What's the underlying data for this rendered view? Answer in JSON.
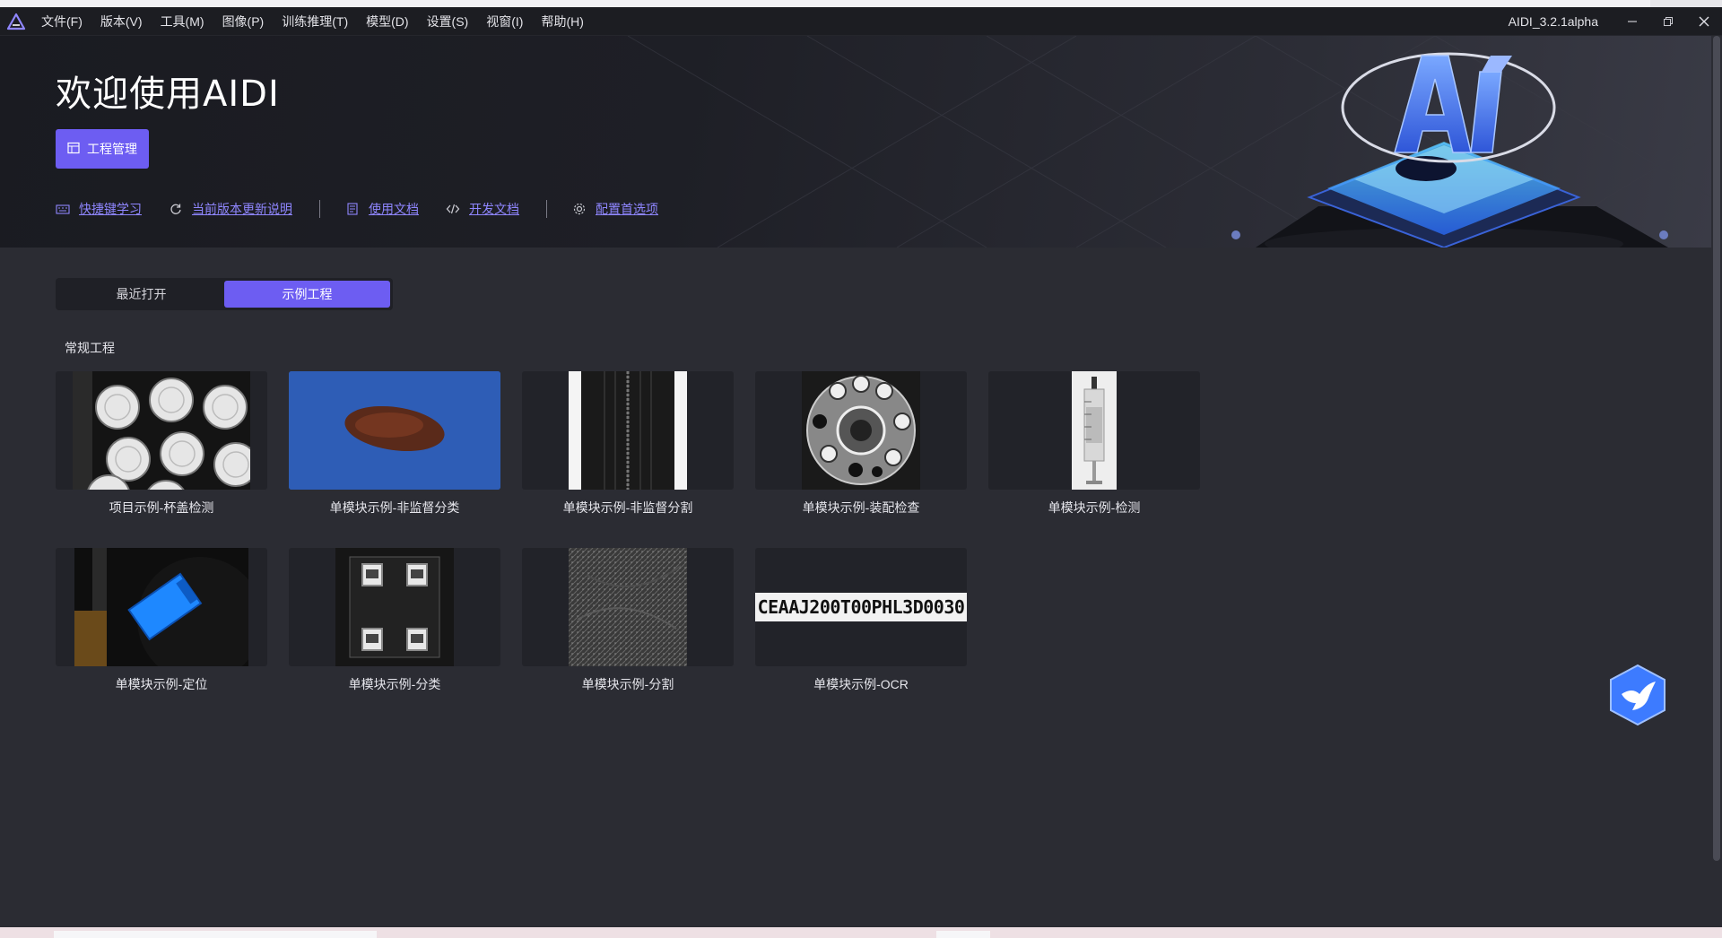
{
  "menubar": {
    "items": [
      "文件(F)",
      "版本(V)",
      "工具(M)",
      "图像(P)",
      "训练推理(T)",
      "模型(D)",
      "设置(S)",
      "视窗(I)",
      "帮助(H)"
    ],
    "app_version": "AIDI_3.2.1alpha",
    "window_controls": [
      "minimize-icon",
      "restore-icon",
      "close-icon"
    ]
  },
  "hero": {
    "title": "欢迎使用AIDI",
    "project_button": "工程管理",
    "links": [
      {
        "label": "快捷键学习",
        "icon": "keyboard-icon"
      },
      {
        "label": "当前版本更新说明",
        "icon": "refresh-icon"
      },
      {
        "label": "使用文档",
        "icon": "document-icon"
      },
      {
        "label": "开发文档",
        "icon": "code-icon"
      },
      {
        "label": "配置首选项",
        "icon": "gear-icon"
      }
    ],
    "art_text": "AI"
  },
  "tabs": {
    "recent": "最近打开",
    "examples": "示例工程",
    "active": "examples"
  },
  "section": {
    "title": "常规工程"
  },
  "projects": [
    {
      "label": "项目示例-杯盖检测",
      "thumb": "cup-lids"
    },
    {
      "label": "单模块示例-非监督分类",
      "thumb": "brown-blob"
    },
    {
      "label": "单模块示例-非监督分割",
      "thumb": "zipper"
    },
    {
      "label": "单模块示例-装配检查",
      "thumb": "gear-plate"
    },
    {
      "label": "单模块示例-检测",
      "thumb": "syringe"
    },
    {
      "label": "单模块示例-定位",
      "thumb": "blue-block"
    },
    {
      "label": "单模块示例-分类",
      "thumb": "chip-pads"
    },
    {
      "label": "单模块示例-分割",
      "thumb": "texture"
    },
    {
      "label": "单模块示例-OCR",
      "thumb": "ocr-strip",
      "ocr_text": "CEAAJ200T00PHL3D0030"
    }
  ],
  "colors": {
    "accent": "#6d5df2",
    "link": "#8f86ff",
    "background": "#2b2c33",
    "card_bg": "#222329"
  }
}
